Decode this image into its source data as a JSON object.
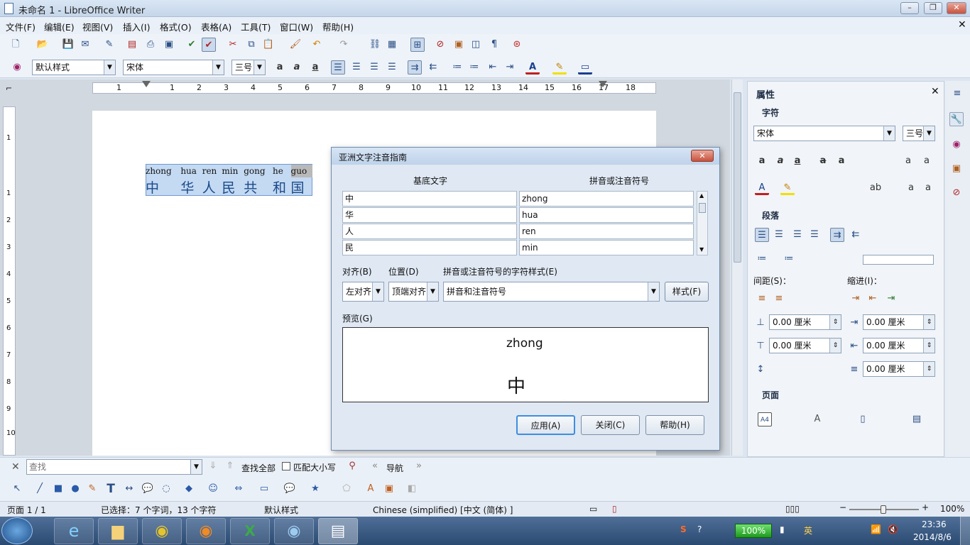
{
  "window": {
    "title": "未命名 1 - LibreOffice Writer"
  },
  "menu": [
    "文件(F)",
    "编辑(E)",
    "视图(V)",
    "插入(I)",
    "格式(O)",
    "表格(A)",
    "工具(T)",
    "窗口(W)",
    "帮助(H)"
  ],
  "format": {
    "style": "默认样式",
    "font": "宋体",
    "size": "三号"
  },
  "ruler": {
    "h": [
      "1",
      "1",
      "2",
      "3",
      "4",
      "5",
      "6",
      "7",
      "8",
      "9",
      "10",
      "11",
      "12",
      "13",
      "14",
      "15",
      "16",
      "17",
      "18"
    ],
    "v": [
      "1",
      "1",
      "2",
      "3",
      "4",
      "5",
      "6",
      "7",
      "8",
      "9",
      "10"
    ]
  },
  "document": {
    "ruby": [
      "zhong",
      "hua",
      "ren",
      "min",
      "gong",
      "he",
      "guo"
    ],
    "base": [
      "中",
      "华",
      "人",
      "民",
      "共",
      "和",
      "国"
    ]
  },
  "sidebar": {
    "title": "属性",
    "sections": {
      "char": "字符",
      "para": "段落",
      "page": "页面"
    },
    "font": "宋体",
    "size": "三号",
    "spacing_label": "间距(S)：",
    "indent_label": "缩进(I)：",
    "values": [
      "0.00 厘米",
      "0.00 厘米",
      "0.00 厘米",
      "0.00 厘米",
      "0.00 厘米"
    ]
  },
  "dialog": {
    "title": "亚洲文字注音指南",
    "col_base": "基底文字",
    "col_ruby": "拼音或注音符号",
    "rows": [
      {
        "base": "中",
        "ruby": "zhong"
      },
      {
        "base": "华",
        "ruby": "hua"
      },
      {
        "base": "人",
        "ruby": "ren"
      },
      {
        "base": "民",
        "ruby": "min"
      }
    ],
    "align_label": "对齐(B)",
    "align_value": "左对齐",
    "position_label": "位置(D)",
    "position_value": "顶端对齐",
    "charstyle_label": "拼音或注音符号的字符样式(E)",
    "charstyle_value": "拼音和注音符号",
    "styles_button": "样式(F)",
    "preview_label": "预览(G)",
    "preview_ruby": "zhong",
    "preview_base": "中",
    "apply": "应用(A)",
    "close": "关闭(C)",
    "help": "帮助(H)"
  },
  "findbar": {
    "placeholder": "查找",
    "find_all": "查找全部",
    "match_case": "匹配大小写",
    "navigation": "导航"
  },
  "status": {
    "page": "页面 1 / 1",
    "selection": "已选择：7 个字词，13 个字符",
    "style": "默认样式",
    "language": "Chinese (simplified) [中文 (简体) ]",
    "zoom": "100%"
  },
  "tray": {
    "battery": "100%",
    "time": "23:36",
    "date": "2014/8/6"
  }
}
